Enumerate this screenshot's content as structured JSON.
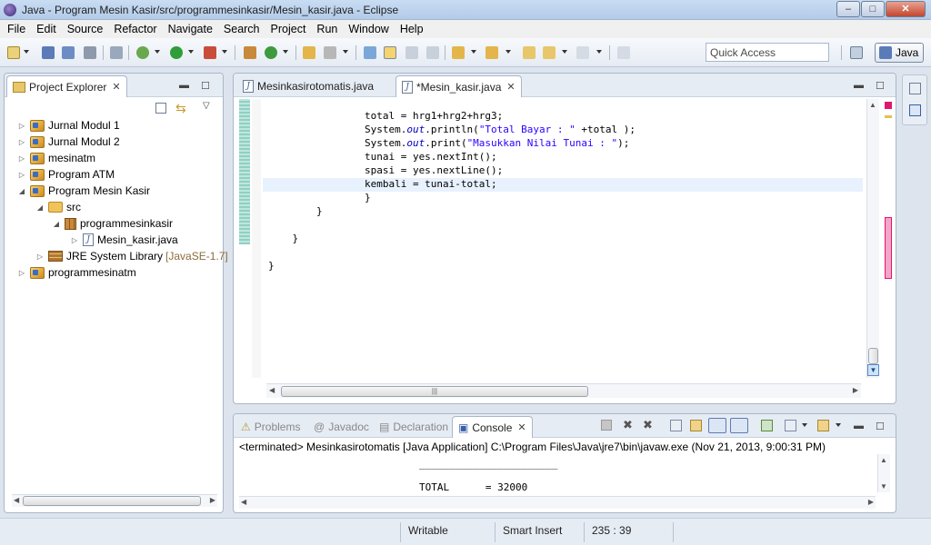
{
  "window": {
    "title": "Java - Program Mesin Kasir/src/programmesinkasir/Mesin_kasir.java - Eclipse",
    "minimize": "–",
    "maximize": "□",
    "close": "✕"
  },
  "menu": [
    "File",
    "Edit",
    "Source",
    "Refactor",
    "Navigate",
    "Search",
    "Project",
    "Run",
    "Window",
    "Help"
  ],
  "toolbar": {
    "quick_access": "Quick Access",
    "perspective": "Java"
  },
  "explorer": {
    "title": "Project Explorer",
    "tree": [
      {
        "label": "Jurnal Modul 1",
        "twisty": "▷",
        "type": "project"
      },
      {
        "label": "Jurnal Modul 2",
        "twisty": "▷",
        "type": "project"
      },
      {
        "label": "mesinatm",
        "twisty": "▷",
        "type": "project"
      },
      {
        "label": "Program ATM",
        "twisty": "▷",
        "type": "project"
      },
      {
        "label": "Program Mesin Kasir",
        "twisty": "◢",
        "type": "project"
      },
      {
        "label": "src",
        "twisty": "◢",
        "type": "folder"
      },
      {
        "label": "programmesinkasir",
        "twisty": "◢",
        "type": "package"
      },
      {
        "label": "Mesin_kasir.java",
        "twisty": "▷",
        "type": "java"
      },
      {
        "label": "JRE System Library",
        "decoration": "[JavaSE-1.7]",
        "twisty": "▷",
        "type": "jre"
      },
      {
        "label": "programmesinatm",
        "twisty": "▷",
        "type": "project"
      }
    ]
  },
  "editor": {
    "tabs": [
      {
        "label": "Mesinkasirotomatis.java",
        "active": false
      },
      {
        "label": "*Mesin_kasir.java",
        "active": true
      }
    ],
    "lines": [
      {
        "plain": "                total = hrg1+hrg2+hrg3;"
      },
      {
        "pre": "                System.",
        "italic": "out",
        "mid": ".println(",
        "str": "\"Total Bayar : \"",
        "post": " +total );"
      },
      {
        "pre": "                System.",
        "italic": "out",
        "mid": ".print(",
        "str": "\"Masukkan Nilai Tunai : \"",
        "post": ");"
      },
      {
        "plain": "                tunai = yes.nextInt();"
      },
      {
        "plain": "                spasi = yes.nextLine();"
      },
      {
        "plain": "                kembali = tunai-total;"
      },
      {
        "plain": "                }"
      },
      {
        "plain": "        }"
      },
      {
        "plain": ""
      },
      {
        "plain": "    }"
      },
      {
        "plain": ""
      },
      {
        "plain": "}"
      }
    ]
  },
  "console": {
    "tabs": [
      {
        "label": "Problems",
        "prefix": "⚠"
      },
      {
        "label": "Javadoc",
        "prefix": "@"
      },
      {
        "label": "Declaration",
        "prefix": "▤"
      },
      {
        "label": "Console",
        "prefix": "▣"
      }
    ],
    "header": "<terminated> Mesinkasirotomatis [Java Application] C:\\Program Files\\Java\\jre7\\bin\\javaw.exe (Nov 21, 2013, 9:00:31 PM)",
    "output": [
      "_______________________",
      "TOTAL      = 32000"
    ]
  },
  "status": {
    "writable": "Writable",
    "insert_mode": "Smart Insert",
    "position": "235 : 39"
  },
  "colors": {
    "keyword_field": "#0000c0",
    "string": "#2a00ff",
    "current_line": "#e8f2fe",
    "change_bar": "#8fd0c3"
  }
}
